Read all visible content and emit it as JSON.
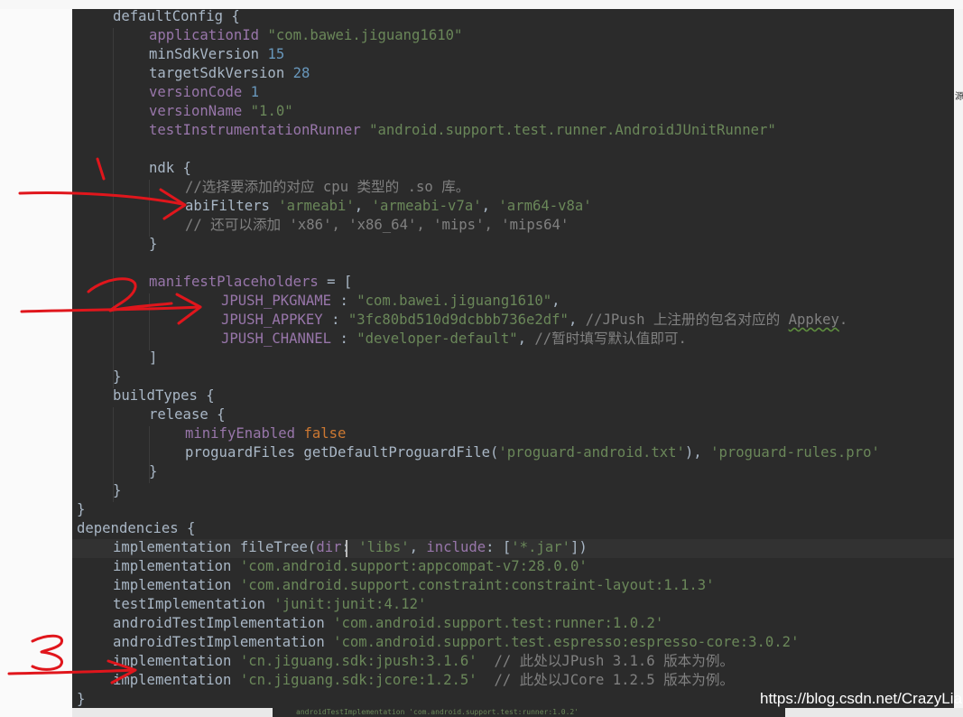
{
  "editor": {
    "lines": [
      {
        "indent": 1,
        "tokens": [
          [
            "id",
            "defaultConfig {"
          ]
        ]
      },
      {
        "indent": 2,
        "tokens": [
          [
            "fld",
            "applicationId "
          ],
          [
            "str",
            "\"com.bawei.jiguang1610\""
          ]
        ]
      },
      {
        "indent": 2,
        "tokens": [
          [
            "id",
            "minSdkVersion "
          ],
          [
            "num",
            "15"
          ]
        ]
      },
      {
        "indent": 2,
        "tokens": [
          [
            "id",
            "targetSdkVersion "
          ],
          [
            "num",
            "28"
          ]
        ]
      },
      {
        "indent": 2,
        "tokens": [
          [
            "fld",
            "versionCode "
          ],
          [
            "num",
            "1"
          ]
        ]
      },
      {
        "indent": 2,
        "tokens": [
          [
            "fld",
            "versionName "
          ],
          [
            "str",
            "\"1.0\""
          ]
        ]
      },
      {
        "indent": 2,
        "tokens": [
          [
            "fld",
            "testInstrumentationRunner "
          ],
          [
            "str",
            "\"android.support.test.runner.AndroidJUnitRunner\""
          ]
        ]
      },
      {
        "indent": 0,
        "tokens": []
      },
      {
        "indent": 2,
        "tokens": [
          [
            "id",
            "ndk {"
          ]
        ]
      },
      {
        "indent": 3,
        "tokens": [
          [
            "cmt",
            "//选择要添加的对应 cpu 类型的 .so 库。"
          ]
        ]
      },
      {
        "indent": 3,
        "tokens": [
          [
            "id",
            "abiFilters "
          ],
          [
            "str",
            "'armeabi'"
          ],
          [
            "id",
            ", "
          ],
          [
            "str",
            "'armeabi-v7a'"
          ],
          [
            "id",
            ", "
          ],
          [
            "str",
            "'arm64-v8a'"
          ]
        ]
      },
      {
        "indent": 3,
        "tokens": [
          [
            "cmt",
            "// 还可以添加 'x86', 'x86_64', 'mips', 'mips64'"
          ]
        ]
      },
      {
        "indent": 2,
        "tokens": [
          [
            "id",
            "}"
          ]
        ]
      },
      {
        "indent": 0,
        "tokens": []
      },
      {
        "indent": 2,
        "tokens": [
          [
            "fld",
            "manifestPlaceholders "
          ],
          [
            "id",
            "= ["
          ]
        ]
      },
      {
        "indent": 4,
        "tokens": [
          [
            "fld",
            "JPUSH_PKGNAME "
          ],
          [
            "id",
            ": "
          ],
          [
            "str",
            "\"com.bawei.jiguang1610\""
          ],
          [
            "id",
            ","
          ]
        ]
      },
      {
        "indent": 4,
        "tokens": [
          [
            "fld",
            "JPUSH_APPKEY "
          ],
          [
            "id",
            ": "
          ],
          [
            "str",
            "\"3fc80bd510d9dcbbb736e2df\""
          ],
          [
            "id",
            ", "
          ],
          [
            "cmt",
            "//JPush 上注册的包名对应的 "
          ],
          [
            "cmtsq",
            "Appkey"
          ],
          [
            "cmt",
            "."
          ]
        ]
      },
      {
        "indent": 4,
        "tokens": [
          [
            "fld",
            "JPUSH_CHANNEL "
          ],
          [
            "id",
            ": "
          ],
          [
            "str",
            "\"developer-default\""
          ],
          [
            "id",
            ", "
          ],
          [
            "cmt",
            "//暂时填写默认值即可."
          ]
        ]
      },
      {
        "indent": 2,
        "tokens": [
          [
            "id",
            "]"
          ]
        ]
      },
      {
        "indent": 1,
        "tokens": [
          [
            "id",
            "}"
          ]
        ]
      },
      {
        "indent": 1,
        "tokens": [
          [
            "id",
            "buildTypes {"
          ]
        ]
      },
      {
        "indent": 2,
        "tokens": [
          [
            "id",
            "release {"
          ]
        ]
      },
      {
        "indent": 3,
        "tokens": [
          [
            "fld",
            "minifyEnabled "
          ],
          [
            "kw",
            "false"
          ]
        ]
      },
      {
        "indent": 3,
        "tokens": [
          [
            "id",
            "proguardFiles getDefaultProguardFile("
          ],
          [
            "str",
            "'proguard-android.txt'"
          ],
          [
            "id",
            "), "
          ],
          [
            "str",
            "'proguard-rules.pro'"
          ]
        ]
      },
      {
        "indent": 2,
        "tokens": [
          [
            "id",
            "}"
          ]
        ]
      },
      {
        "indent": 1,
        "tokens": [
          [
            "id",
            "}"
          ]
        ]
      },
      {
        "indent": 0,
        "tokens": [
          [
            "id",
            "}"
          ]
        ]
      },
      {
        "indent": 0,
        "tokens": [
          [
            "id",
            "dependencies {"
          ]
        ]
      },
      {
        "indent": 1,
        "tokens": [
          [
            "id",
            "implementation fileTree("
          ],
          [
            "fld",
            "dir"
          ],
          [
            "id",
            ": "
          ],
          [
            "str",
            "'libs'"
          ],
          [
            "id",
            ", "
          ],
          [
            "fld",
            "include"
          ],
          [
            "id",
            ": ["
          ],
          [
            "str",
            "'*.jar'"
          ],
          [
            "id",
            "])"
          ]
        ]
      },
      {
        "indent": 1,
        "tokens": [
          [
            "id",
            "implementation "
          ],
          [
            "str",
            "'com.android.support:appcompat-v7:28.0.0'"
          ]
        ]
      },
      {
        "indent": 1,
        "tokens": [
          [
            "id",
            "implementation "
          ],
          [
            "str",
            "'com.android.support.constraint:constraint-layout:1.1.3'"
          ]
        ]
      },
      {
        "indent": 1,
        "tokens": [
          [
            "id",
            "testImplementation "
          ],
          [
            "str",
            "'junit:junit:4.12'"
          ]
        ]
      },
      {
        "indent": 1,
        "tokens": [
          [
            "id",
            "androidTestImplementation "
          ],
          [
            "str",
            "'com.android.support.test:runner:1.0.2'"
          ]
        ]
      },
      {
        "indent": 1,
        "tokens": [
          [
            "id",
            "androidTestImplementation "
          ],
          [
            "str",
            "'com.android.support.test.espresso:espresso-core:3.0.2'"
          ]
        ]
      },
      {
        "indent": 1,
        "tokens": [
          [
            "id",
            "implementation "
          ],
          [
            "str",
            "'cn.jiguang.sdk:jpush:3.1.6'"
          ],
          [
            "cmt",
            "  // 此处以JPush 3.1.6 版本为例。"
          ]
        ]
      },
      {
        "indent": 1,
        "tokens": [
          [
            "id",
            "implementation "
          ],
          [
            "str",
            "'cn.jiguang.sdk:jcore:1.2.5'"
          ],
          [
            "cmt",
            "  // 此处以JCore 1.2.5 版本为例。"
          ]
        ]
      },
      {
        "indent": 0,
        "tokens": [
          [
            "id",
            "}"
          ]
        ]
      }
    ]
  },
  "annotations": {
    "marks": [
      "1",
      "2",
      "3"
    ],
    "color": "#e0161c"
  },
  "watermark": "https://blog.csdn.net/CrazyLiar",
  "background_fragments": {
    "right_edge_glyph": "源",
    "bottom_strip_text": "androidTestImplementation 'com.android.support.test:runner:1.0.2'"
  },
  "colors": {
    "editor_bg": "#2b2b2b",
    "text": "#a9b7c6",
    "string": "#6a8759",
    "number": "#6897bb",
    "comment": "#808080",
    "field": "#9876aa",
    "keyword": "#cc7832",
    "annotation": "#e0161c"
  }
}
